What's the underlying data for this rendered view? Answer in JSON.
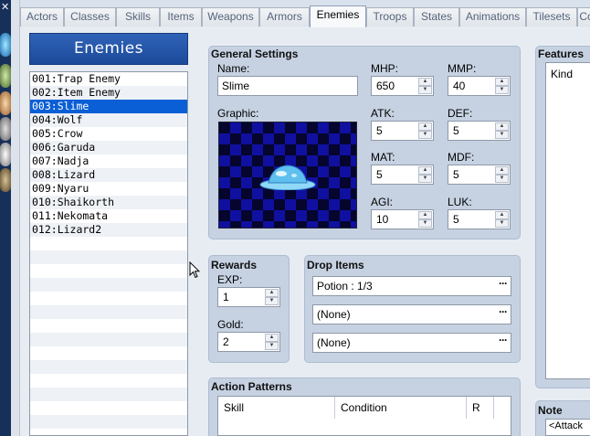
{
  "tabs": [
    "Actors",
    "Classes",
    "Skills",
    "Items",
    "Weapons",
    "Armors",
    "Enemies",
    "Troops",
    "States",
    "Animations",
    "Tilesets",
    "Co"
  ],
  "active_tab": "Enemies",
  "left_strip": {
    "close_glyph": "✕"
  },
  "list": {
    "header": "Enemies",
    "items": [
      "001:Trap Enemy",
      "002:Item Enemy",
      "003:Slime",
      "004:Wolf",
      "005:Crow",
      "006:Garuda",
      "007:Nadja",
      "008:Lizard",
      "009:Nyaru",
      "010:Shaikorth",
      "011:Nekomata",
      "012:Lizard2"
    ],
    "selected_index": 2
  },
  "general": {
    "title": "General Settings",
    "name_label": "Name:",
    "name_value": "Slime",
    "graphic_label": "Graphic:",
    "params": {
      "mhp": {
        "label": "MHP:",
        "value": "650"
      },
      "mmp": {
        "label": "MMP:",
        "value": "40"
      },
      "atk": {
        "label": "ATK:",
        "value": "5"
      },
      "def": {
        "label": "DEF:",
        "value": "5"
      },
      "mat": {
        "label": "MAT:",
        "value": "5"
      },
      "mdf": {
        "label": "MDF:",
        "value": "5"
      },
      "agi": {
        "label": "AGI:",
        "value": "10"
      },
      "luk": {
        "label": "LUK:",
        "value": "5"
      }
    }
  },
  "rewards": {
    "title": "Rewards",
    "exp_label": "EXP:",
    "exp_value": "1",
    "gold_label": "Gold:",
    "gold_value": "2"
  },
  "drop_items": {
    "title": "Drop Items",
    "items": [
      "Potion : 1/3",
      "(None)",
      "(None)"
    ],
    "ellipsis": "···"
  },
  "features": {
    "title": "Features",
    "kind_header": "Kind"
  },
  "action_patterns": {
    "title": "Action Patterns",
    "columns": [
      "Skill",
      "Condition",
      "R"
    ]
  },
  "note": {
    "title": "Note",
    "text": "<Attack"
  },
  "colors": {
    "list_header": "#2f63b8",
    "selection": "#0a5fd6",
    "group_bg": "#c6d2e2"
  }
}
